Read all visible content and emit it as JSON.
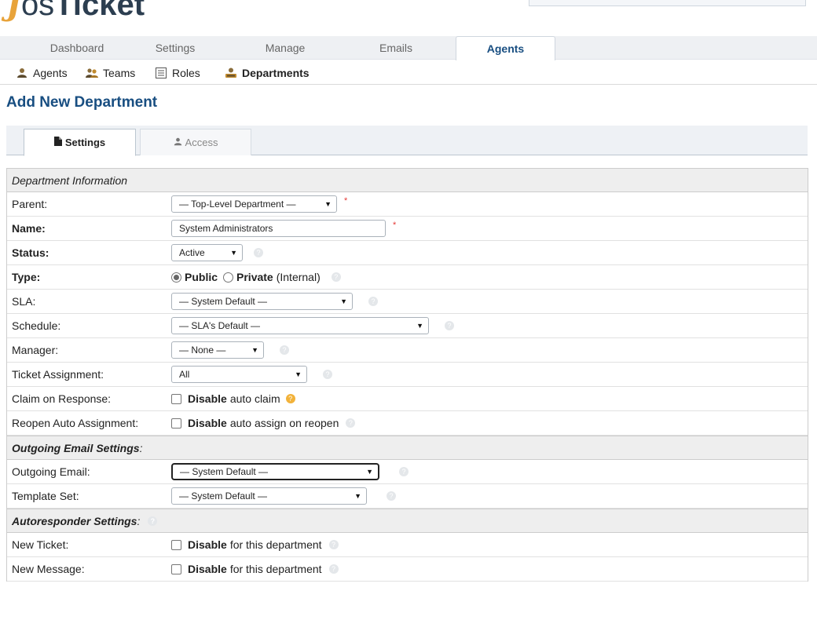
{
  "logo": {
    "prefix": "os",
    "suffix": "Ticket"
  },
  "nav": {
    "tabs": [
      "Dashboard",
      "Settings",
      "Manage",
      "Emails",
      "Agents"
    ],
    "active": "Agents"
  },
  "subnav": {
    "items": [
      "Agents",
      "Teams",
      "Roles",
      "Departments"
    ],
    "active": "Departments"
  },
  "page_title": "Add New Department",
  "form_tabs": [
    "Settings",
    "Access"
  ],
  "sections": {
    "dept_info": "Department Information",
    "outgoing": "Outgoing Email Settings",
    "autoresponder": "Autoresponder Settings",
    "colon": ":"
  },
  "fields": {
    "parent": {
      "label": "Parent:",
      "value": "— Top-Level Department —"
    },
    "name": {
      "label": "Name:",
      "value": "System Administrators"
    },
    "status": {
      "label": "Status:",
      "value": "Active"
    },
    "type": {
      "label": "Type:",
      "public": "Public",
      "private": "Private",
      "private_note": "(Internal)"
    },
    "sla": {
      "label": "SLA:",
      "value": "— System Default —"
    },
    "schedule": {
      "label": "Schedule:",
      "value": "— SLA's Default —"
    },
    "manager": {
      "label": "Manager:",
      "value": "— None —"
    },
    "ticket_assignment": {
      "label": "Ticket Assignment:",
      "value": "All"
    },
    "claim": {
      "label": "Claim on Response:",
      "strong": "Disable",
      "text": "auto claim"
    },
    "reopen": {
      "label": "Reopen Auto Assignment:",
      "strong": "Disable",
      "text": "auto assign on reopen"
    },
    "outgoing_email": {
      "label": "Outgoing Email:",
      "value": "— System Default —"
    },
    "template_set": {
      "label": "Template Set:",
      "value": "— System Default —"
    },
    "new_ticket": {
      "label": "New Ticket:",
      "strong": "Disable",
      "text": "for this department"
    },
    "new_message": {
      "label": "New Message:",
      "strong": "Disable",
      "text": "for this department"
    }
  },
  "required_mark": "*",
  "help_glyph": "?",
  "icons": {
    "agents": "user-icon",
    "teams": "users-icon",
    "roles": "list-icon",
    "departments": "sitemap-icon",
    "settings_tab": "file-icon",
    "access_tab": "user-icon"
  },
  "colors": {
    "accent": "#184E81",
    "logo_orange": "#e8a33a",
    "required": "#e53935",
    "warn_help": "#f2b23a"
  }
}
